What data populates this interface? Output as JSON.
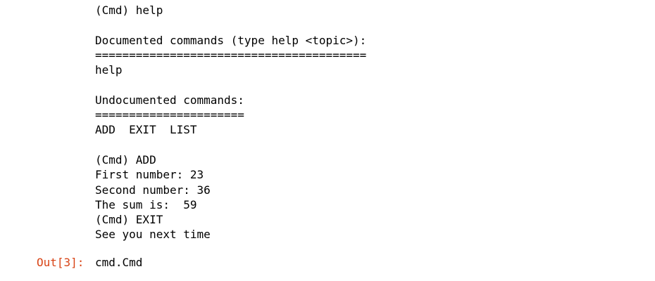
{
  "stdout": {
    "lines": [
      "(Cmd) help",
      "",
      "Documented commands (type help <topic>):",
      "========================================",
      "help",
      "",
      "Undocumented commands:",
      "======================",
      "ADD  EXIT  LIST",
      "",
      "(Cmd) ADD",
      "First number: 23",
      "Second number: 36",
      "The sum is:  59",
      "(Cmd) EXIT",
      "See you next time"
    ]
  },
  "out_cell": {
    "prompt": "Out[3]:",
    "value": "cmd.Cmd"
  },
  "colors": {
    "out_prompt": "#d84315",
    "text": "#000000",
    "background": "#ffffff"
  }
}
